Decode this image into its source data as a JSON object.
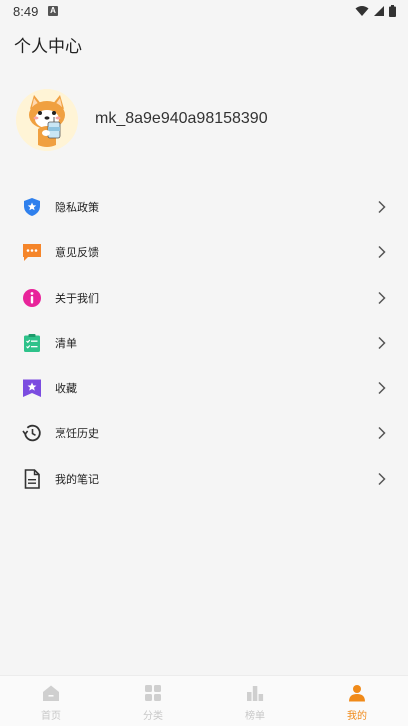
{
  "status_bar": {
    "time": "8:49",
    "notification_badge": "A"
  },
  "page": {
    "title": "个人中心"
  },
  "profile": {
    "username": "mk_8a9e940a98158390"
  },
  "menu": [
    {
      "label": "隐私政策",
      "icon": "shield-star-icon",
      "color": "#2f80ed"
    },
    {
      "label": "意见反馈",
      "icon": "chat-bubble-icon",
      "color": "#f5852a"
    },
    {
      "label": "关于我们",
      "icon": "info-circle-icon",
      "color": "#e8249a"
    },
    {
      "label": "清单",
      "icon": "checklist-icon",
      "color": "#2ec28a"
    },
    {
      "label": "收藏",
      "icon": "bookmark-star-icon",
      "color": "#7b4ce0"
    },
    {
      "label": "烹饪历史",
      "icon": "history-icon",
      "color": "#333333"
    },
    {
      "label": "我的笔记",
      "icon": "document-icon",
      "color": "#333333"
    }
  ],
  "tabs": [
    {
      "label": "首页",
      "icon": "home-icon",
      "active": false
    },
    {
      "label": "分类",
      "icon": "grid-icon",
      "active": false
    },
    {
      "label": "榜单",
      "icon": "ranking-icon",
      "active": false
    },
    {
      "label": "我的",
      "icon": "person-icon",
      "active": true
    }
  ],
  "colors": {
    "accent": "#f08a19",
    "inactive": "#c8c8c8",
    "background": "#f5f5f5"
  }
}
